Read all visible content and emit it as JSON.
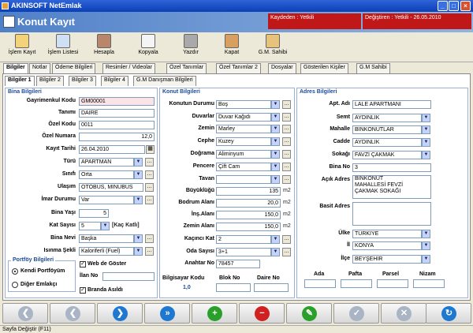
{
  "window": {
    "title": "AKINSOFT NetEmlak"
  },
  "header": {
    "title": "Konut Kayıt",
    "kaydeden": "Kaydeden : Yetkili",
    "degistiren": "Değiştiren :",
    "degistiren_value": "Yetkili - 26.05.2010"
  },
  "toolbar": [
    "İşlem Kayıt",
    "İşlem Listesi",
    "Hesapla",
    "Kopyala",
    "Yazdır",
    "Kapat",
    "G.M. Sahibi"
  ],
  "main_tabs": [
    "Bilgiler",
    "Notlar",
    "Ödeme Bilgileri",
    "Resimler / Videolar",
    "Özel Tanımlar",
    "Özel Tanımlar 2",
    "Dosyalar",
    "Gösterilen Kişiler",
    "G.M Sahibi"
  ],
  "sub_tabs": [
    "Bilgiler 1",
    "Bilgiler 2",
    "Bilgiler 3",
    "Bilgiler 4",
    "G.M Danışman Bilgileri"
  ],
  "bina": {
    "title": "Bina Bilgileri",
    "labels": {
      "kod": "Gayrimenkul Kodu",
      "tanim": "Tanımı",
      "ozel_kod": "Özel Kodu",
      "ozel_numara": "Özel Numara",
      "kayit_tarihi": "Kayıt Tarihi",
      "turu": "Türü",
      "sinifi": "Sınıfı",
      "ulasim": "Ulaşım",
      "imar": "İmar Durumu",
      "bina_yasi": "Bina Yaşı",
      "kat_sayisi": "Kat Sayısı",
      "bina_nevi": "Bina Nevi",
      "isinma": "Isınma Şekli"
    },
    "values": {
      "kod": "GM00001",
      "tanim": "DAİRE",
      "ozel_kod": "0011",
      "ozel_numara": "12,0",
      "kayit_tarihi": "26.04.2010",
      "turu": "APARTMAN",
      "sinifi": "Orta",
      "ulasim": "OTOBÜS, MİNÜBÜS",
      "imar": "Var",
      "bina_yasi": "5",
      "kat_sayisi": "5",
      "kat_katli": "[Kaç Katlı]",
      "bina_nevi": "Başka",
      "isinma": "Kaloriferli (Fuel)"
    }
  },
  "portfoy": {
    "title": "Portföy Bilgileri",
    "opt1": "Kendi Portföyüm",
    "opt2": "Diğer Emlakçı",
    "web": "Web de Göster",
    "ilan_no": "İlan No",
    "branda": "Branda Asıldı"
  },
  "konut": {
    "title": "Konut Bilgileri",
    "labels": {
      "durum": "Konutun Durumu",
      "duvar": "Duvarlar",
      "zemin": "Zemin",
      "cephe": "Cephe",
      "dograma": "Doğrama",
      "pencere": "Pencere",
      "tavan": "Tavan",
      "buyukluk": "Büyüklüğü",
      "bodrum": "Bodrum Alanı",
      "ins": "İnş.Alanı",
      "zemin_alani": "Zemin Alanı",
      "kacinci": "Kaçıncı Kat",
      "oda": "Oda Sayısı",
      "anahtar": "Anahtar No"
    },
    "values": {
      "durum": "Boş",
      "duvar": "Duvar Kağıdı",
      "zemin": "Marley",
      "cephe": "Kuzey",
      "dograma": "Aliminyum",
      "pencere": "Çift Cam",
      "tavan": "",
      "buyukluk": "135",
      "bodrum": "20,0",
      "ins": "150,0",
      "zemin_alani": "150,0",
      "kacinci": "2",
      "oda": "3+1",
      "anahtar": "78457"
    },
    "unit": "m2"
  },
  "bilgisayar": {
    "kod_label": "Bilgisayar Kodu",
    "kod_value": "1,0",
    "blok_label": "Blok No",
    "daire_label": "Daire No"
  },
  "adres": {
    "title": "Adres Bilgileri",
    "labels": {
      "apt": "Apt. Adı",
      "semt": "Semt",
      "mahalle": "Mahalle",
      "cadde": "Cadde",
      "sokak": "Sokağı",
      "bina_no": "Bina No",
      "acik": "Açık Adres",
      "basit": "Basit Adres",
      "ulke": "Ülke",
      "il": "İl",
      "ilce": "İlçe"
    },
    "values": {
      "apt": "LALE APARTMANI",
      "semt": "AYDINLIK",
      "mahalle": "BİNKONUTLAR",
      "cadde": "AYDINLIK",
      "sokak": "FAVZİ ÇAKMAK",
      "bina_no": "3",
      "acik_line1": "BİNKONUT",
      "acik_line2": "MAHALLESİ FEVZİ",
      "acik_line3": "ÇAKMAK SOKAĞI",
      "basit": "",
      "ulke": "TÜRKİYE",
      "il": "KONYA",
      "ilce": "BEYŞEHİR"
    },
    "parsel_labels": [
      "Ada",
      "Pafta",
      "Parsel",
      "Nizam"
    ]
  },
  "status": {
    "text": "Sayfa Değiştir (F11)"
  }
}
